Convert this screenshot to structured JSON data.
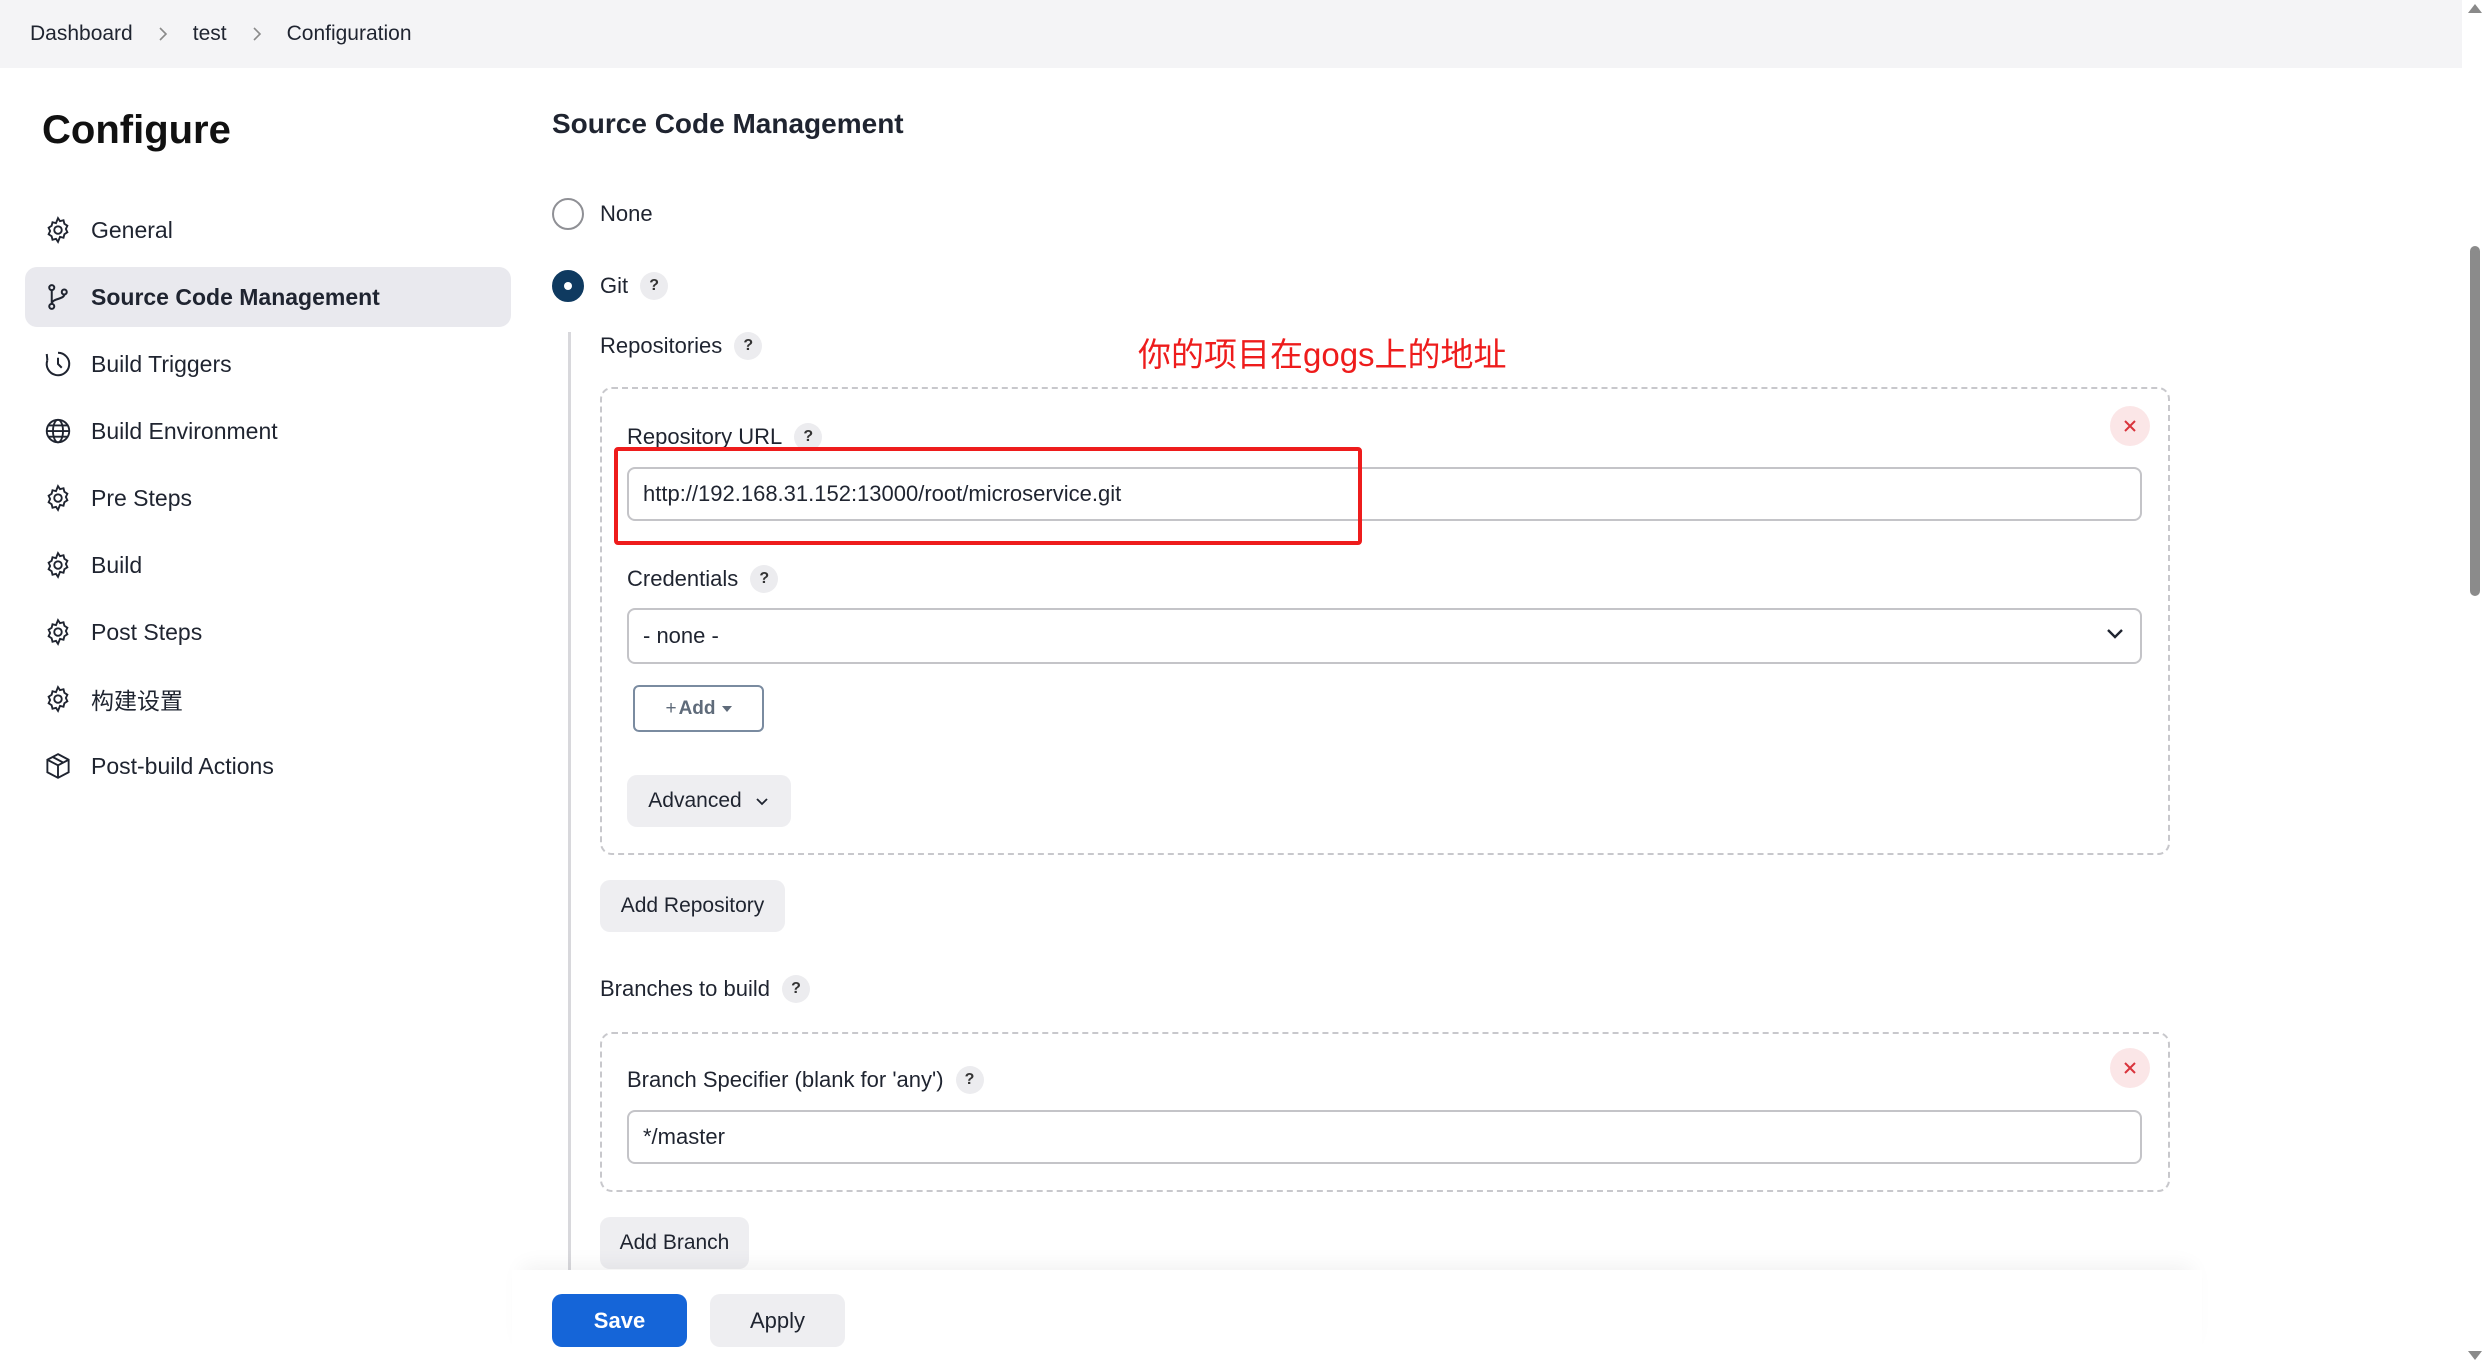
{
  "breadcrumb": [
    "Dashboard",
    "test",
    "Configuration"
  ],
  "sidebar": {
    "title": "Configure",
    "items": [
      {
        "label": "General",
        "icon": "gear-icon"
      },
      {
        "label": "Source Code Management",
        "icon": "git-branch-icon"
      },
      {
        "label": "Build Triggers",
        "icon": "clock-icon"
      },
      {
        "label": "Build Environment",
        "icon": "globe-icon"
      },
      {
        "label": "Pre Steps",
        "icon": "gear-icon"
      },
      {
        "label": "Build",
        "icon": "gear-icon"
      },
      {
        "label": "Post Steps",
        "icon": "gear-icon"
      },
      {
        "label": "构建设置",
        "icon": "gear-icon"
      },
      {
        "label": "Post-build Actions",
        "icon": "package-icon"
      }
    ],
    "active_index": 1
  },
  "scm": {
    "title": "Source Code Management",
    "options": [
      {
        "label": "None",
        "selected": false
      },
      {
        "label": "Git",
        "selected": true
      }
    ],
    "help": "?",
    "repositories_label": "Repositories",
    "repository_url_label": "Repository URL",
    "repository_url_value": "http://192.168.31.152:13000/root/microservice.git",
    "credentials_label": "Credentials",
    "credentials_value": "- none -",
    "add_button": "Add",
    "add_prefix": "+",
    "advanced_button": "Advanced",
    "add_repository_button": "Add Repository",
    "branches_label": "Branches to build",
    "branch_specifier_label": "Branch Specifier (blank for 'any')",
    "branch_specifier_value": "*/master",
    "add_branch_button": "Add Branch"
  },
  "annotation": {
    "text": "你的项目在gogs上的地址",
    "color": "#ee1c1c"
  },
  "footer": {
    "save": "Save",
    "apply": "Apply"
  },
  "colors": {
    "primary": "#1565d8",
    "radio_checked": "#0f3a60",
    "annotation": "#ee1c1c"
  }
}
